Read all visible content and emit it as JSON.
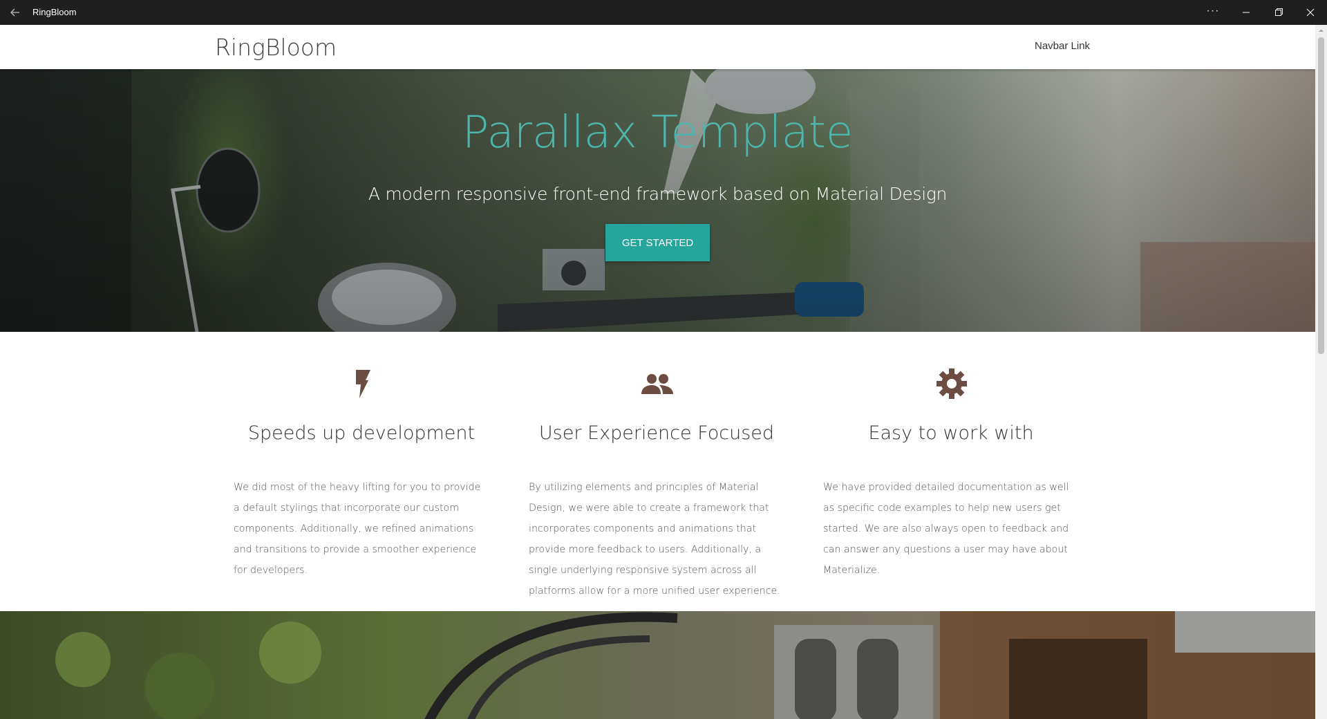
{
  "window": {
    "title": "RingBloom",
    "more_label": "···"
  },
  "navbar": {
    "brand": "RingBloom",
    "link": "Navbar Link"
  },
  "hero": {
    "title": "Parallax Template",
    "subtitle": "A modern responsive front-end framework based on Material Design",
    "cta_label": "GET STARTED"
  },
  "features": [
    {
      "icon": "flash-icon",
      "title": "Speeds up development",
      "text": "We did most of the heavy lifting for you to provide a default stylings that incorporate our custom components. Additionally, we refined animations and transitions to provide a smoother experience for developers."
    },
    {
      "icon": "group-icon",
      "title": "User Experience Focused",
      "text": "By utilizing elements and principles of Material Design, we were able to create a framework that incorporates components and animations that provide more feedback to users. Additionally, a single underlying responsive system across all platforms allow for a more unified user experience."
    },
    {
      "icon": "settings-icon",
      "title": "Easy to work with",
      "text": "We have provided detailed documentation as well as specific code examples to help new users get started. We are also always open to feedback and can answer any questions a user may have about Materialize."
    }
  ],
  "colors": {
    "accent": "#26a69a",
    "hero_title": "#4db6ac",
    "icon": "#6d4c41",
    "titlebar": "#1f1f1f"
  }
}
